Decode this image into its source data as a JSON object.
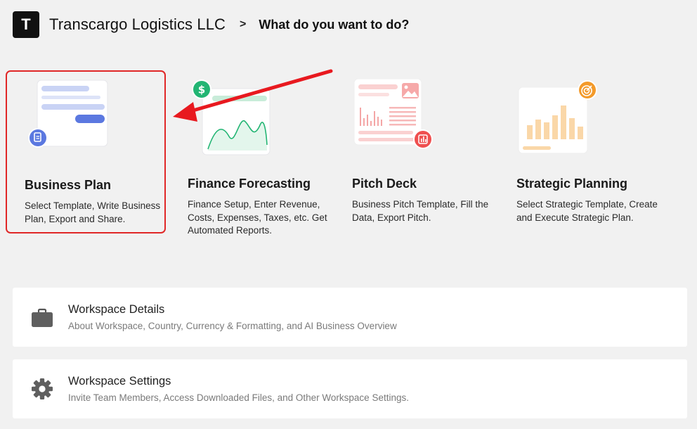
{
  "header": {
    "logo_letter": "T",
    "company": "Transcargo Logistics LLC",
    "separator": ">",
    "prompt": "What do you want to do?"
  },
  "cards": [
    {
      "title": "Business Plan",
      "description": "Select Template, Write Business Plan, Export and Share.",
      "badge_icon": "document-icon",
      "selected": true
    },
    {
      "title": "Finance Forecasting",
      "description": "Finance Setup, Enter Revenue, Costs, Expenses, Taxes, etc. Get Automated Reports.",
      "badge_icon": "dollar-icon",
      "selected": false
    },
    {
      "title": "Pitch Deck",
      "description": "Business Pitch Template, Fill the Data, Export Pitch.",
      "badge_icon": "chart-icon",
      "selected": false
    },
    {
      "title": "Strategic Planning",
      "description": "Select Strategic Template, Create and Execute Strategic Plan.",
      "badge_icon": "target-icon",
      "selected": false
    }
  ],
  "panels": [
    {
      "title": "Workspace Details",
      "description": "About Workspace, Country, Currency & Formatting, and AI Business Overview",
      "icon": "briefcase-icon"
    },
    {
      "title": "Workspace Settings",
      "description": "Invite Team Members, Access Downloaded Files, and Other Workspace Settings.",
      "icon": "gear-icon"
    }
  ],
  "colors": {
    "selection_border": "#e02727",
    "annotation_arrow": "#e8191f",
    "business_accent": "#5b78e0",
    "finance_accent": "#22b573",
    "pitch_accent": "#ef4f4f",
    "strategy_accent": "#f39a2a"
  }
}
